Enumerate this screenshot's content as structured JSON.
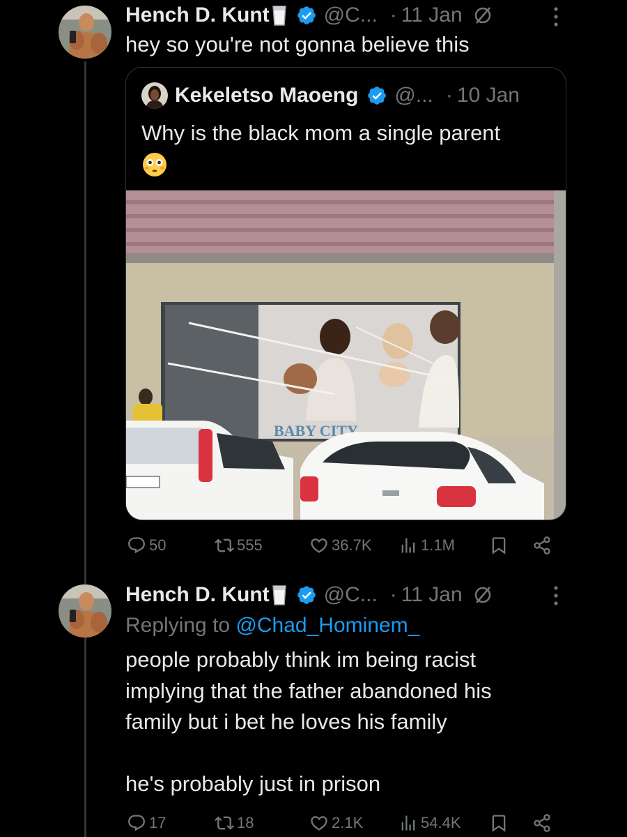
{
  "tweet1": {
    "author_name": "Hench D. Kunt",
    "handle": "@C...",
    "date": "11 Jan",
    "text": "hey so you're not gonna believe this",
    "quoted": {
      "author_name": "Kekeletso Maoeng",
      "handle": "@...",
      "date": "10 Jan",
      "text": "Why is the black mom a single parent",
      "emoji": "flushed-face-emoji",
      "photo_signage": "BABY CITY"
    },
    "stats": {
      "replies": "50",
      "reposts": "555",
      "likes": "36.7K",
      "views": "1.1M"
    }
  },
  "tweet2": {
    "author_name": "Hench D. Kunt",
    "handle": "@C...",
    "date": "11 Jan",
    "replying_label": "Replying to",
    "replying_handle": "@Chad_Hominem_",
    "text_lines": [
      "people probably think im being racist",
      "implying that the father abandoned his",
      "family but i bet he loves his family",
      "he's probably just in prison"
    ],
    "stats": {
      "replies": "17",
      "reposts": "18",
      "likes": "2.1K",
      "views": "54.4K"
    }
  },
  "dot_separator": "·",
  "colors": {
    "background": "#000000",
    "text": "#e7e9ea",
    "secondary": "#71767b",
    "link": "#1d9bf0",
    "border": "#2f3336"
  }
}
